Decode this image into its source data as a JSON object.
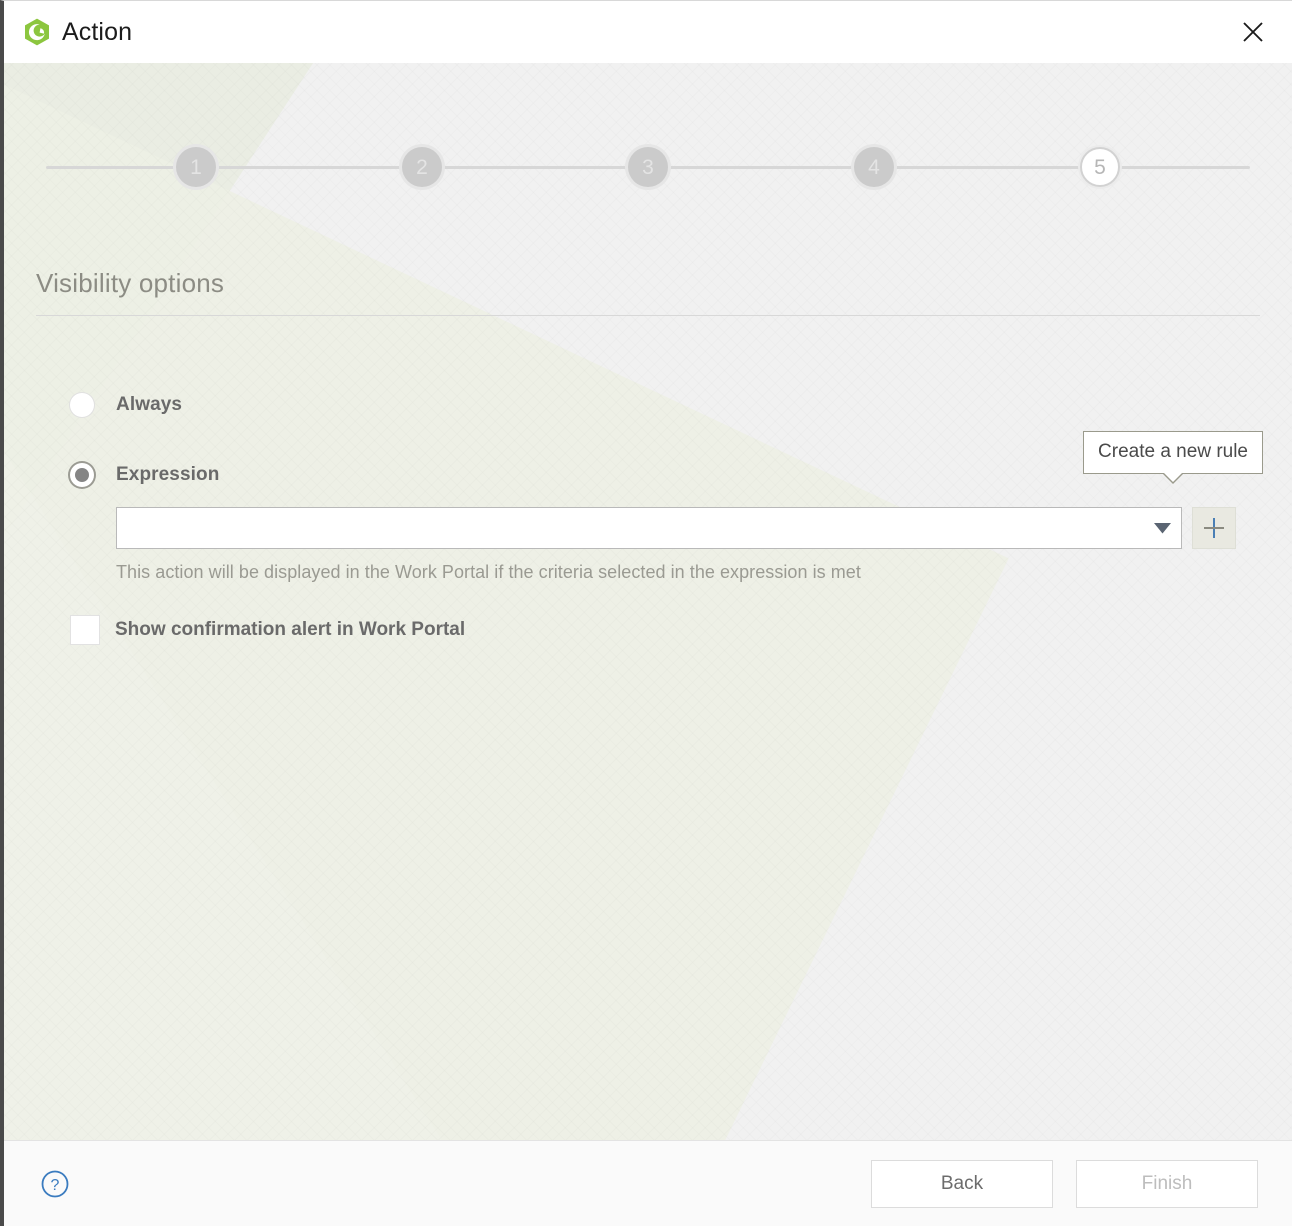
{
  "window": {
    "title": "Action",
    "logo_icon": "green-hexagon-logo",
    "close_icon": "close-icon"
  },
  "stepper": {
    "steps": [
      {
        "label": "1",
        "state": "done"
      },
      {
        "label": "2",
        "state": "done"
      },
      {
        "label": "3",
        "state": "done"
      },
      {
        "label": "4",
        "state": "done"
      },
      {
        "label": "5",
        "state": "current"
      }
    ]
  },
  "section": {
    "title": "Visibility options"
  },
  "visibility": {
    "always": {
      "label": "Always",
      "selected": false
    },
    "expression": {
      "label": "Expression",
      "selected": true,
      "combo_value": "",
      "combo_placeholder": "",
      "dropdown_icon": "chevron-down-icon",
      "add_icon": "plus-icon",
      "hint": "This action will be displayed in the Work Portal if the criteria selected in the expression is met"
    },
    "confirmation": {
      "label": "Show confirmation alert in Work Portal",
      "checked": false
    }
  },
  "tooltip": {
    "text": "Create a new rule"
  },
  "footer": {
    "help_icon": "help-question-icon",
    "back_label": "Back",
    "finish_label": "Finish"
  },
  "colors": {
    "brand_green": "#8cc63f",
    "accent_blue": "#3a7bbf",
    "tooltip_border": "#9a9a8c",
    "content_bg": "#f1f1f1",
    "decor_olive": "#eaece1"
  }
}
